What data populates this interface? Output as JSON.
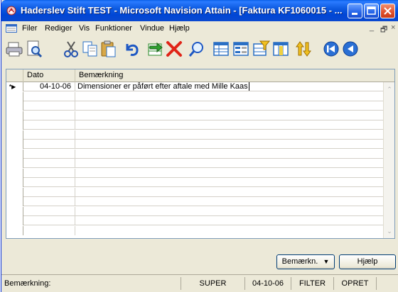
{
  "window": {
    "title": "Haderslev Stift TEST - Microsoft Navision Attain - [Faktura KF1060015 - ...",
    "app_icon": "navision-app-icon"
  },
  "menu": {
    "items": [
      "Filer",
      "Rediger",
      "Vis",
      "Funktioner",
      "Vindue",
      "Hjælp"
    ],
    "mdi_minimize": "_",
    "mdi_restore": "🗗",
    "mdi_close": "×"
  },
  "toolbar": {
    "icons": [
      "print-icon",
      "print-preview-icon",
      "cut-icon",
      "copy-icon",
      "paste-icon",
      "undo-icon",
      "insert-icon",
      "delete-icon",
      "find-icon",
      "table-icon",
      "form-icon",
      "filter-icon",
      "flowfilter-icon",
      "sort-icon",
      "first-icon",
      "previous-icon"
    ]
  },
  "grid": {
    "columns": [
      "Dato",
      "Bemærkning"
    ],
    "rows": [
      {
        "marker": "*▶",
        "date": "04-10-06",
        "remark": "Dimensioner er påført efter aftale med Mille Kaas"
      }
    ],
    "empty_rows": 15
  },
  "buttons": {
    "remarks": "Bemærkn.",
    "remarks_arrow": "▼",
    "help": "Hjælp"
  },
  "statusbar": {
    "field": "Bemærkning:",
    "user": "SUPER",
    "date": "04-10-06",
    "filter": "FILTER",
    "mode": "OPRET"
  },
  "colors": {
    "titlebar": "#0046d5",
    "window_bg": "#ece9d8",
    "grid_border": "#7f9db9"
  }
}
